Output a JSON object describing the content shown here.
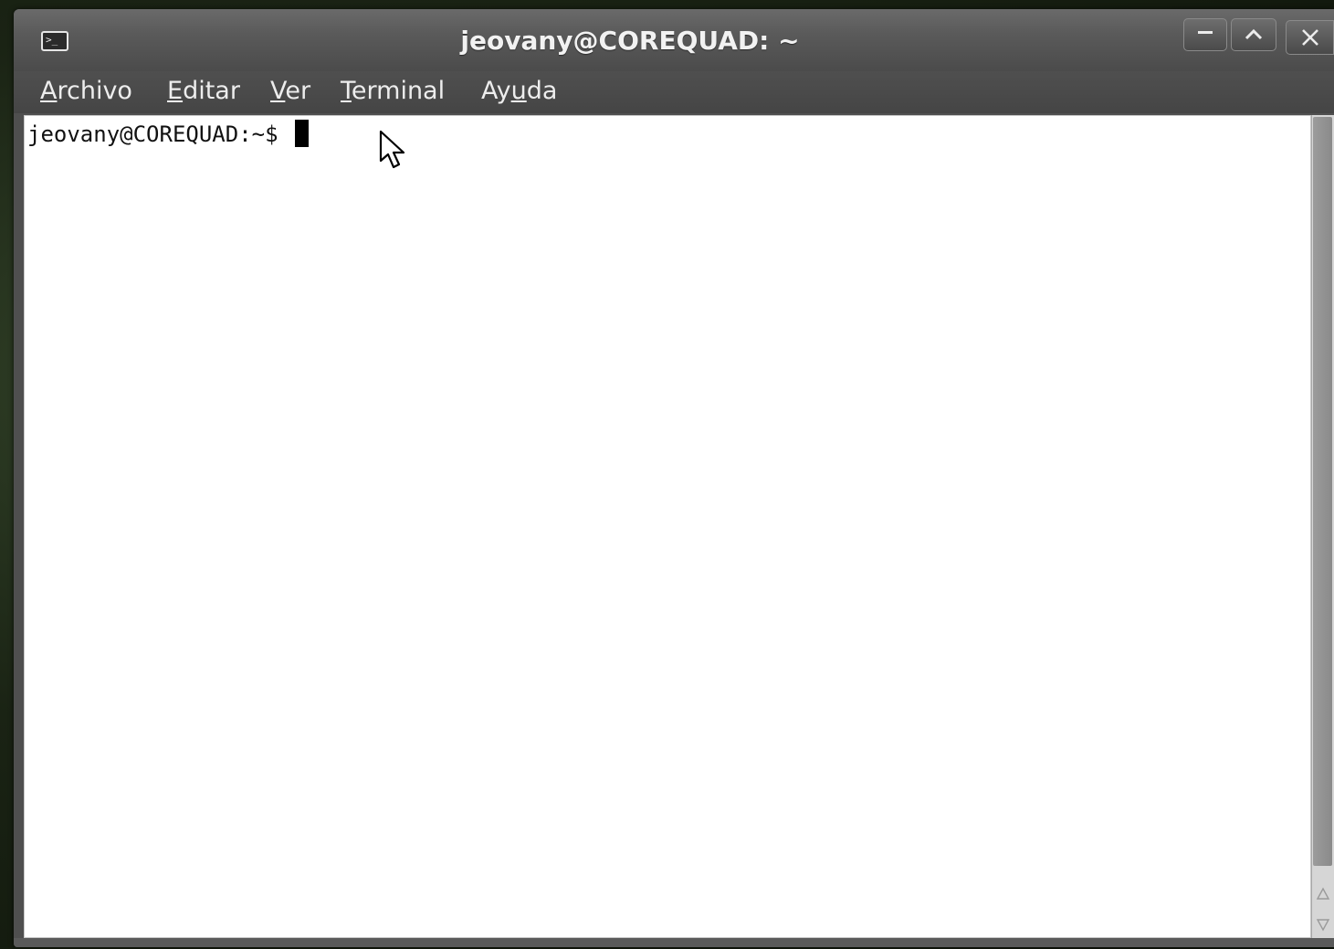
{
  "window": {
    "title": "jeovany@COREQUAD: ~",
    "title_icon_glyph": ">_"
  },
  "window_controls": {
    "minimize_icon": "minimize-icon",
    "maximize_icon": "maximize-icon",
    "close_icon": "close-icon"
  },
  "menubar": {
    "items": [
      {
        "mnemonic": "A",
        "rest": "rchivo"
      },
      {
        "mnemonic": "E",
        "rest": "ditar"
      },
      {
        "mnemonic": "V",
        "rest": "er"
      },
      {
        "mnemonic": "T",
        "rest": "erminal"
      },
      {
        "pre": "Ay",
        "mnemonic": "u",
        "rest": "da"
      }
    ]
  },
  "terminal": {
    "prompt": "jeovany@COREQUAD:~$ ",
    "input": ""
  },
  "colors": {
    "terminal_background": "#ffffff",
    "terminal_text": "#111111",
    "window_chrome": "#4f4f4f",
    "title_text": "#f2f2f2"
  }
}
